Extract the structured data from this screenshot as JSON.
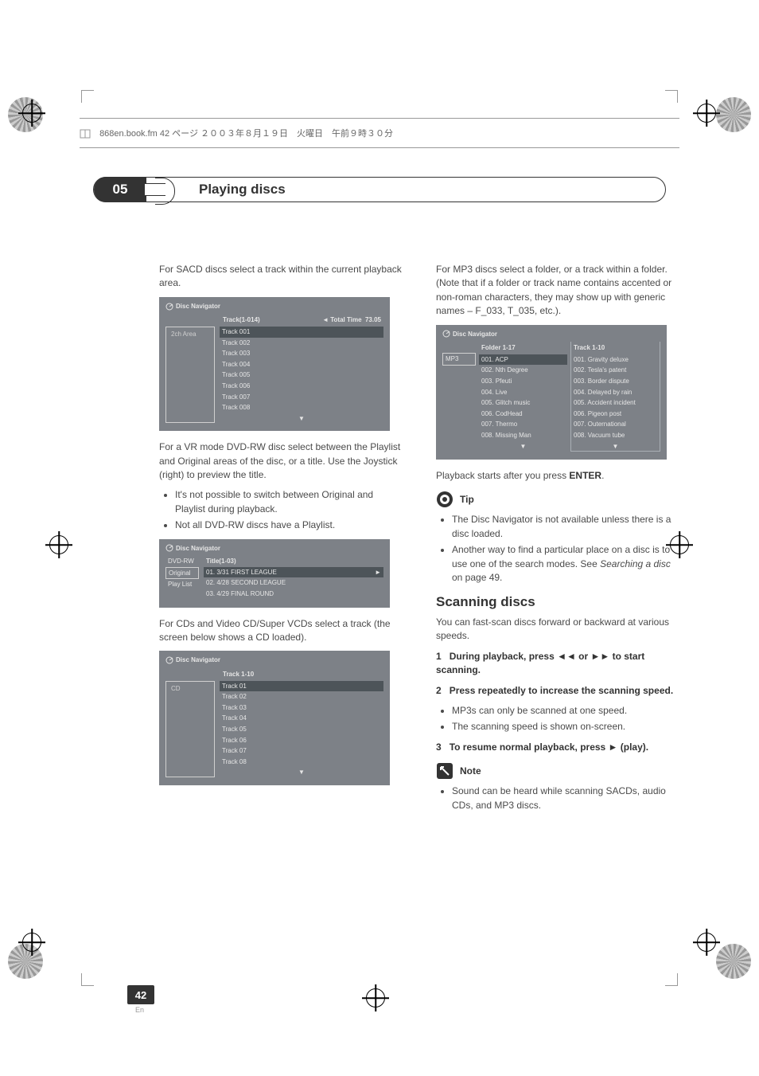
{
  "header": {
    "filename_line": "868en.book.fm 42 ページ ２００３年８月１９日　火曜日　午前９時３０分"
  },
  "chapter": {
    "number": "05",
    "title": "Playing discs"
  },
  "left": {
    "p1": "For SACD discs select a track within the current playback area.",
    "nav1": {
      "title": "Disc Navigator",
      "leftcell": "2ch Area",
      "header_left": "Track(1-014)",
      "header_right_label": "Total Time",
      "header_right_value": "73.05",
      "items": [
        "Track 001",
        "Track 002",
        "Track 003",
        "Track 004",
        "Track 005",
        "Track 006",
        "Track 007",
        "Track 008"
      ]
    },
    "p2": "For a VR mode DVD-RW disc select between the Playlist and Original areas of the disc, or a title. Use the Joystick (right) to preview the title.",
    "bullets1": [
      "It's not possible to switch between Original and Playlist during playback.",
      "Not all DVD-RW discs have a Playlist."
    ],
    "nav2": {
      "title": "Disc Navigator",
      "side": [
        "DVD-RW",
        "Original",
        "Play List"
      ],
      "header": "Title(1-03)",
      "items": [
        "01. 3/31 FIRST LEAGUE",
        "02. 4/28 SECOND LEAGUE",
        "03. 4/29 FINAL ROUND"
      ]
    },
    "p3": "For CDs and Video CD/Super VCDs select a track (the screen below shows a CD loaded).",
    "nav3": {
      "title": "Disc Navigator",
      "leftcell": "CD",
      "header": "Track 1-10",
      "items": [
        "Track 01",
        "Track 02",
        "Track 03",
        "Track 04",
        "Track 05",
        "Track 06",
        "Track 07",
        "Track 08"
      ]
    }
  },
  "right": {
    "p1": "For MP3 discs select a folder, or a track within a folder. (Note that if a folder or track name contains accented or non-roman characters, they may show up with generic names – F_033, T_035, etc.).",
    "nav4": {
      "title": "Disc Navigator",
      "leftcell": "MP3",
      "col1_header": "Folder 1-17",
      "col1_items": [
        "001. ACP",
        "002. Nth Degree",
        "003. Pfeuti",
        "004. Live",
        "005. Glitch music",
        "006. CodHead",
        "007. Thermo",
        "008. Missing Man"
      ],
      "col2_header": "Track 1-10",
      "col2_items": [
        "001. Gravity deluxe",
        "002. Tesla's patent",
        "003. Border dispute",
        "004. Delayed by rain",
        "005. Accident incident",
        "006. Pigeon post",
        "007. Outernational",
        "008. Vacuum tube"
      ]
    },
    "p2_a": "Playback starts after you press ",
    "p2_b": "ENTER",
    "p2_c": ".",
    "tip_label": "Tip",
    "tip_bullets": [
      "The Disc Navigator is not available unless there is a disc loaded."
    ],
    "tip_bullet2_a": "Another way to find a particular place on a disc is to use one of the search modes. See ",
    "tip_bullet2_b": "Searching a disc",
    "tip_bullet2_c": " on page 49.",
    "h2": "Scanning discs",
    "p3": "You can fast-scan discs forward or backward at various speeds.",
    "step1_num": "1",
    "step1_a": "During playback, press ◄◄ or ►► to start scanning.",
    "step2_num": "2",
    "step2": "Press repeatedly to increase the scanning speed.",
    "step2_bullets": [
      "MP3s can only be scanned at one speed.",
      "The scanning speed is shown on-screen."
    ],
    "step3_num": "3",
    "step3": "To resume normal playback, press ► (play).",
    "note_label": "Note",
    "note_bullets": [
      "Sound can be heard while scanning SACDs, audio CDs, and MP3 discs."
    ]
  },
  "footer": {
    "page": "42",
    "lang": "En"
  }
}
